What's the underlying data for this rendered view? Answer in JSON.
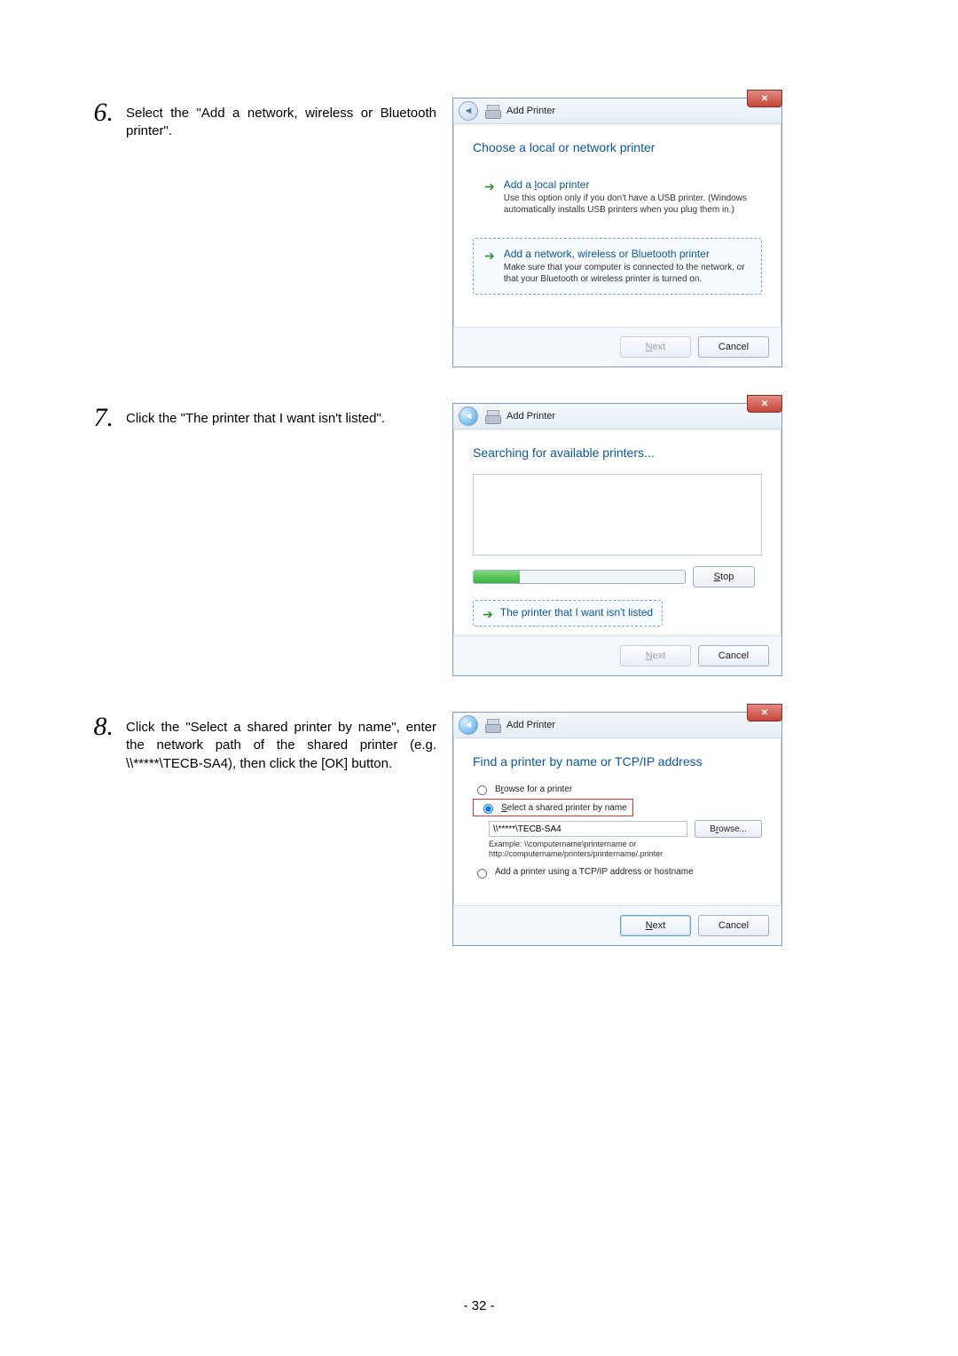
{
  "pageNumber": "- 32 -",
  "steps": {
    "s6": {
      "num": "6.",
      "text": "Select the \"Add a network, wireless or Bluetooth printer\"."
    },
    "s7": {
      "num": "7.",
      "text": "Click the \"The printer that I want isn't listed\"."
    },
    "s8": {
      "num": "8.",
      "text": "Click the \"Select a shared printer by name\", enter the network path of the shared printer (e.g. \\\\*****\\TECB-SA4), then click the [OK] button."
    }
  },
  "win1": {
    "title": "Add Printer",
    "heading": "Choose a local or network printer",
    "opt1": {
      "title_pre": "Add a ",
      "title_mn": "l",
      "title_post": "ocal printer",
      "desc": "Use this option only if you don't have a USB printer. (Windows automatically installs USB printers when you plug them in.)"
    },
    "opt2": {
      "title": "Add a network, wireless or Bluetooth printer",
      "desc": "Make sure that your computer is connected to the network, or that your Bluetooth or wireless printer is turned on."
    },
    "next_pre": "",
    "next_mn": "N",
    "next_post": "ext",
    "cancel": "Cancel"
  },
  "win2": {
    "title": "Add Printer",
    "heading": "Searching for available printers...",
    "stop_mn": "S",
    "stop_post": "top",
    "link": "The printer that I want isn't listed",
    "next_mn": "N",
    "next_post": "ext",
    "cancel": "Cancel"
  },
  "win3": {
    "title": "Add Printer",
    "heading": "Find a printer by name or TCP/IP address",
    "r1_pre": "B",
    "r1_mn": "r",
    "r1_post": "owse for a printer",
    "r2_mn": "S",
    "r2_post": "elect a shared printer by name",
    "path": "\\\\*****\\TECB-SA4",
    "browse_pre": "B",
    "browse_mn": "r",
    "browse_post": "owse...",
    "example": "Example: \\\\computername\\printername or http://computername/printers/printername/.printer",
    "r3": "Add a printer using a TCP/IP address or hostname",
    "next_mn": "N",
    "next_post": "ext",
    "cancel": "Cancel"
  }
}
